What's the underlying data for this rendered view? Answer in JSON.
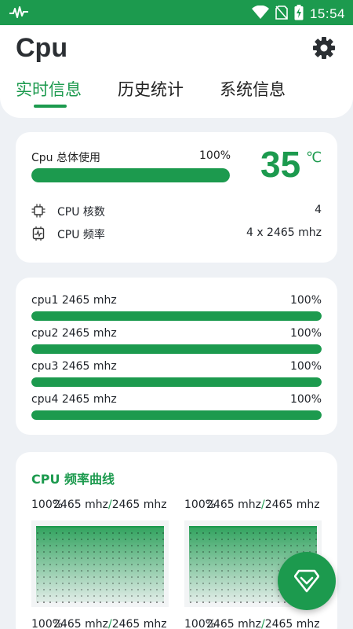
{
  "status_bar": {
    "time": "15:54",
    "icons": [
      "activity-icon",
      "wifi-icon",
      "no-sim-icon",
      "battery-charging-icon"
    ]
  },
  "header": {
    "title": "Cpu",
    "settings_icon": "gear-icon",
    "tabs": [
      {
        "label": "实时信息",
        "active": true
      },
      {
        "label": "历史统计",
        "active": false
      },
      {
        "label": "系统信息",
        "active": false
      }
    ]
  },
  "overview": {
    "usage_label": "Cpu 总体使用",
    "usage_percent_text": "100%",
    "usage_fraction": 1.0,
    "temperature": "35",
    "temperature_unit": "℃",
    "cores_label": "CPU 核数",
    "cores_value": "4",
    "freq_label": "CPU 频率",
    "freq_value": "4 x 2465 mhz"
  },
  "cores": [
    {
      "name": "cpu1  2465 mhz",
      "percent_text": "100%",
      "fraction": 1.0
    },
    {
      "name": "cpu2  2465 mhz",
      "percent_text": "100%",
      "fraction": 1.0
    },
    {
      "name": "cpu3  2465 mhz",
      "percent_text": "100%",
      "fraction": 1.0
    },
    {
      "name": "cpu4  2465 mhz",
      "percent_text": "100%",
      "fraction": 1.0
    }
  ],
  "freq_curves": {
    "title": "CPU 频率曲线",
    "graphs": [
      {
        "percent": "100%",
        "current": "2465 mhz",
        "max": "2465 mhz"
      },
      {
        "percent": "100%",
        "current": "2465 mhz",
        "max": "2465 mhz"
      },
      {
        "percent": "100%",
        "current": "2465 mhz",
        "max": "2465 mhz"
      },
      {
        "percent": "100%",
        "current": "2465 mhz",
        "max": "2465 mhz"
      }
    ],
    "separator": "/"
  },
  "fab_icon": "diamond-chevron-icon",
  "colors": {
    "accent": "#1c9a4e",
    "bar_track": "#e3e7eb",
    "background": "#eef1f5"
  }
}
